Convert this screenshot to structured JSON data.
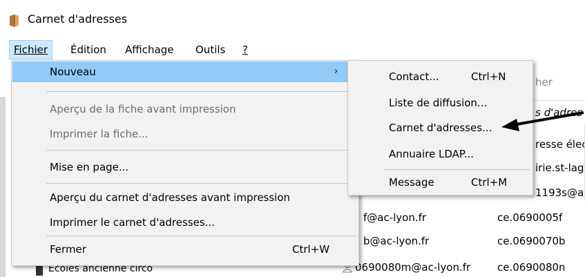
{
  "window": {
    "title": "Carnet d'adresses"
  },
  "menubar": {
    "items": [
      {
        "label": "Fichier"
      },
      {
        "label": "Édition"
      },
      {
        "label": "Affichage"
      },
      {
        "label": "Outils"
      },
      {
        "label": "?"
      }
    ]
  },
  "file_menu": {
    "nouveau": "Nouveau",
    "apercu_fiche": "Aperçu de la fiche avant impression",
    "imprimer_fiche": "Imprimer la fiche...",
    "mise_en_page": "Mise en page...",
    "apercu_carnet": "Aperçu du carnet d'adresses avant impression",
    "imprimer_carnet": "Imprimer le carnet d'adresses...",
    "fermer": "Fermer",
    "fermer_shortcut": "Ctrl+W",
    "arrow": "›"
  },
  "submenu": {
    "contact": "Contact...",
    "contact_shortcut": "Ctrl+N",
    "liste": "Liste de diffusion...",
    "carnet": "Carnet d'adresses...",
    "annuaire": "Annuaire LDAP...",
    "message": "Message",
    "message_shortcut": "Ctrl+M"
  },
  "background": {
    "toolbar_partial": "her",
    "col_header_partial": "s d'adres",
    "row1_partial": "resse élec",
    "row2_partial": "irie.st-lag",
    "row3_partial": "1193s@a",
    "row4_col1": "f@ac-lyon.fr",
    "row4_col2": "ce.0690005f",
    "row5_col1": "b@ac-lyon.fr",
    "row5_col2": "ce.0690070b",
    "row6_col1": "0690080m@ac-lyon.fr",
    "row6_col2": "ce.0690080n",
    "sidebar_partial": "Ecoles ancienne circo"
  }
}
